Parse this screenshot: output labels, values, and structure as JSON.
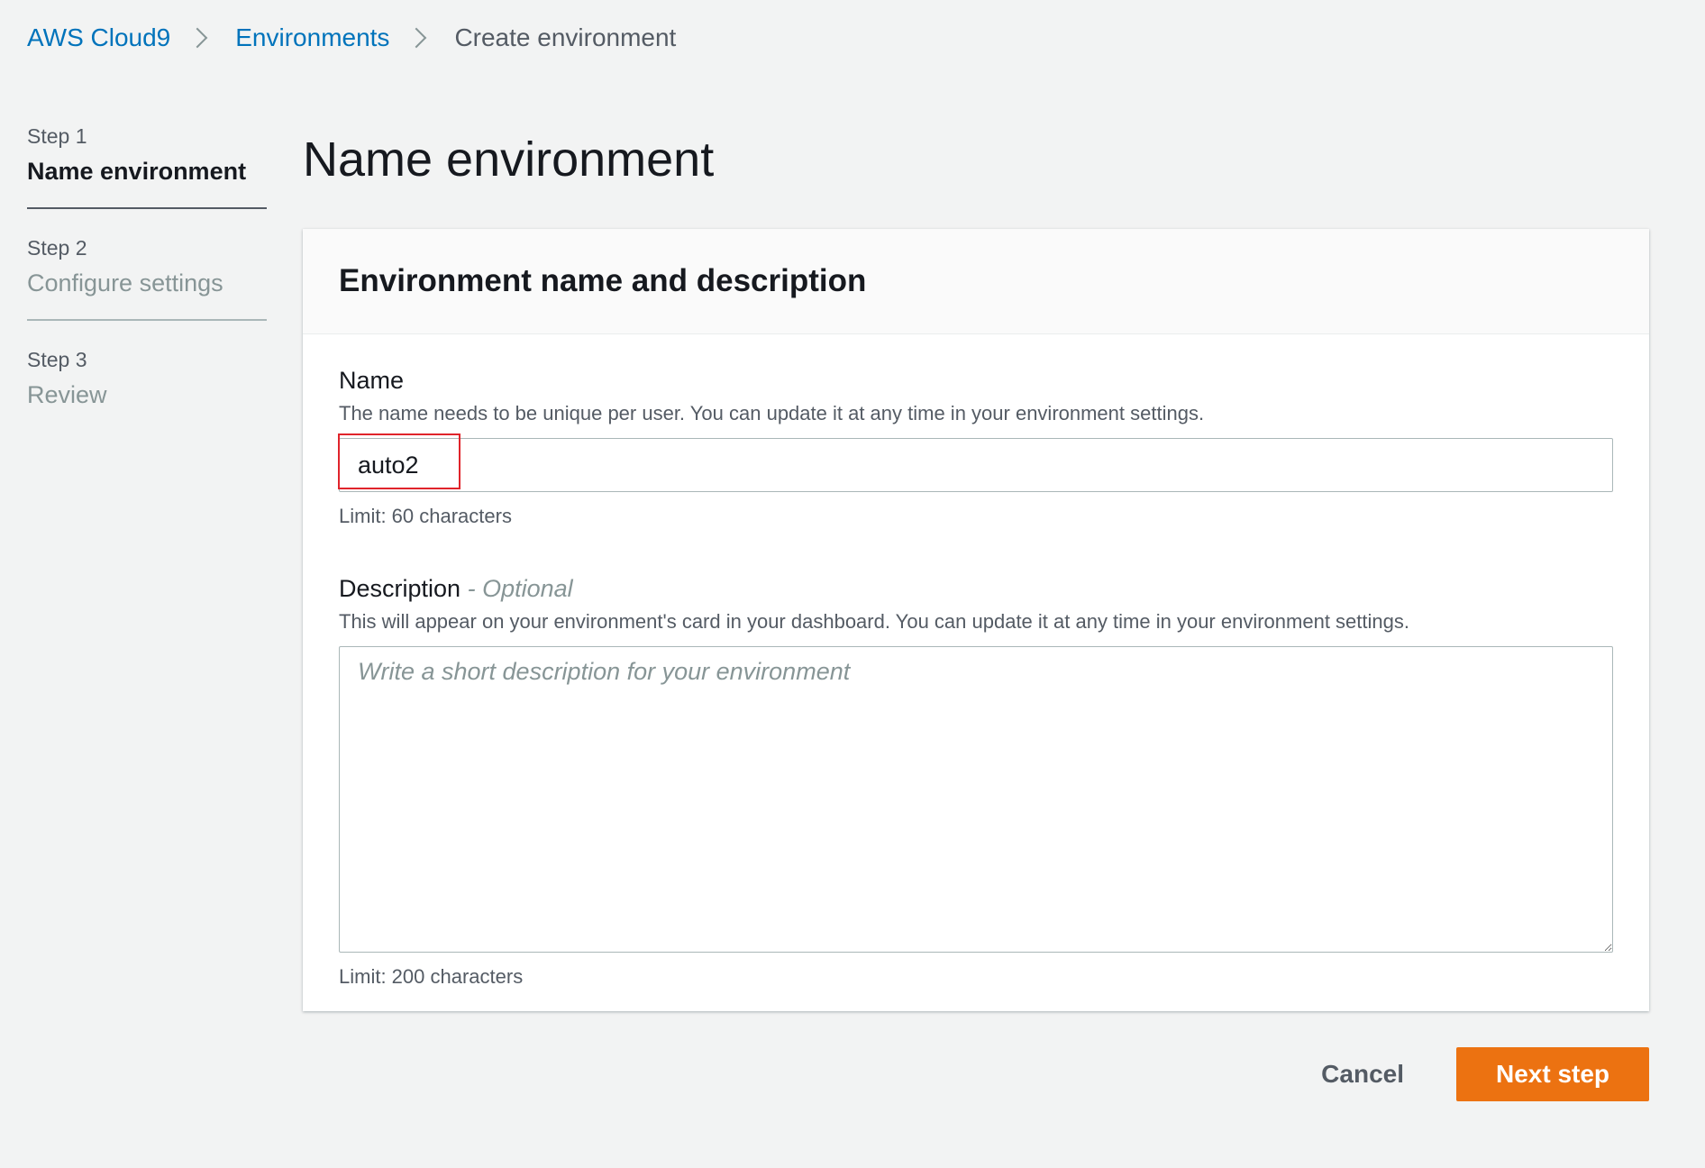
{
  "breadcrumb": {
    "items": [
      {
        "label": "AWS Cloud9"
      },
      {
        "label": "Environments"
      },
      {
        "label": "Create environment"
      }
    ]
  },
  "steps": [
    {
      "number": "Step 1",
      "title": "Name environment",
      "state": "active"
    },
    {
      "number": "Step 2",
      "title": "Configure settings",
      "state": "inactive"
    },
    {
      "number": "Step 3",
      "title": "Review",
      "state": "inactive"
    }
  ],
  "page": {
    "title": "Name environment"
  },
  "container": {
    "title": "Environment name and description"
  },
  "name_field": {
    "label": "Name",
    "hint": "The name needs to be unique per user. You can update it at any time in your environment settings.",
    "value": "auto2",
    "constraint": "Limit: 60 characters"
  },
  "description_field": {
    "label": "Description",
    "optional": "- Optional",
    "hint": "This will appear on your environment's card in your dashboard. You can update it at any time in your environment settings.",
    "placeholder": "Write a short description for your environment",
    "constraint": "Limit: 200 characters"
  },
  "actions": {
    "cancel_label": "Cancel",
    "next_label": "Next step"
  },
  "colors": {
    "link": "#0073bb",
    "primary_button": "#ec7211",
    "highlight": "#e0242b",
    "background": "#f2f3f3"
  }
}
